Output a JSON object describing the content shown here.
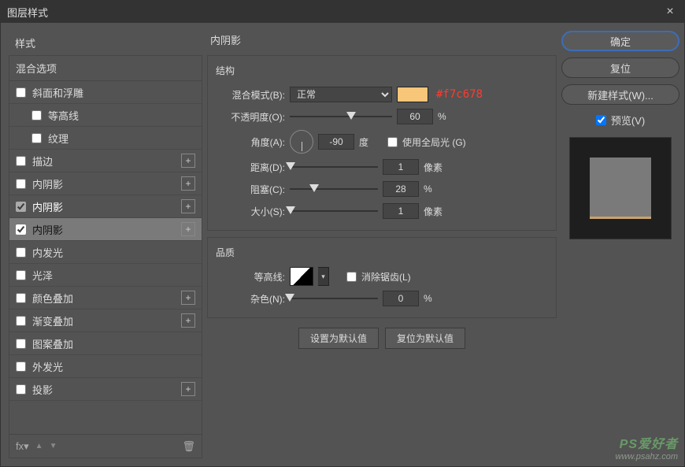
{
  "window": {
    "title": "图层样式",
    "close": "×"
  },
  "left": {
    "header": "样式",
    "blend": "混合选项",
    "items": [
      {
        "label": "斜面和浮雕",
        "checked": false,
        "plus": false,
        "indent": false
      },
      {
        "label": "等高线",
        "checked": false,
        "plus": false,
        "indent": true
      },
      {
        "label": "纹理",
        "checked": false,
        "plus": false,
        "indent": true
      },
      {
        "label": "描边",
        "checked": false,
        "plus": true,
        "indent": false
      },
      {
        "label": "内阴影",
        "checked": false,
        "plus": true,
        "indent": false
      },
      {
        "label": "内阴影",
        "checked": true,
        "plus": true,
        "indent": false,
        "highlight": "checked"
      },
      {
        "label": "内阴影",
        "checked": true,
        "plus": true,
        "indent": false,
        "highlight": "selected"
      },
      {
        "label": "内发光",
        "checked": false,
        "plus": false,
        "indent": false
      },
      {
        "label": "光泽",
        "checked": false,
        "plus": false,
        "indent": false
      },
      {
        "label": "颜色叠加",
        "checked": false,
        "plus": true,
        "indent": false
      },
      {
        "label": "渐变叠加",
        "checked": false,
        "plus": true,
        "indent": false
      },
      {
        "label": "图案叠加",
        "checked": false,
        "plus": false,
        "indent": false
      },
      {
        "label": "外发光",
        "checked": false,
        "plus": false,
        "indent": false
      },
      {
        "label": "投影",
        "checked": false,
        "plus": true,
        "indent": false
      }
    ],
    "footer": {
      "fx": "fx",
      "up": "▲",
      "down": "▼",
      "trash": "🗑"
    }
  },
  "panel": {
    "title": "内阴影",
    "structure": {
      "title": "结构",
      "blendMode": {
        "label": "混合模式(B):",
        "value": "正常",
        "color": "#f7c678",
        "annot": "#f7c678"
      },
      "opacity": {
        "label": "不透明度(O):",
        "value": "60",
        "unit": "%",
        "pct": 60
      },
      "angle": {
        "label": "角度(A):",
        "value": "-90",
        "unit": "度",
        "globalLabel": "使用全局光 (G)",
        "global": false
      },
      "distance": {
        "label": "距离(D):",
        "value": "1",
        "unit": "像素",
        "pct": 1
      },
      "choke": {
        "label": "阻塞(C):",
        "value": "28",
        "unit": "%",
        "pct": 28
      },
      "size": {
        "label": "大小(S):",
        "value": "1",
        "unit": "像素",
        "pct": 1
      }
    },
    "quality": {
      "title": "品质",
      "contour": {
        "label": "等高线:",
        "antiAlias": "消除锯齿(L)"
      },
      "noise": {
        "label": "杂色(N):",
        "value": "0",
        "unit": "%",
        "pct": 0
      }
    },
    "buttons": {
      "default": "设置为默认值",
      "reset": "复位为默认值"
    }
  },
  "right": {
    "ok": "确定",
    "cancel": "复位",
    "newStyle": "新建样式(W)...",
    "preview": "预览(V)"
  },
  "watermark": {
    "site": "www.psahz.com",
    "brand": "PS爱好者"
  }
}
